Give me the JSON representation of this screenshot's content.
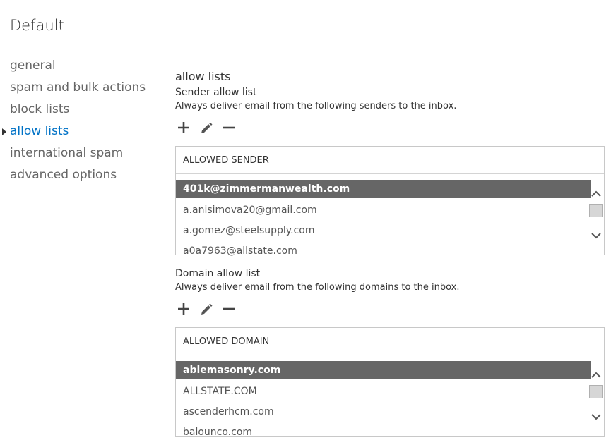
{
  "page": {
    "title": "Default"
  },
  "nav": {
    "items": [
      {
        "label": "general"
      },
      {
        "label": "spam and bulk actions"
      },
      {
        "label": "block lists"
      },
      {
        "label": "allow lists"
      },
      {
        "label": "international spam"
      },
      {
        "label": "advanced options"
      }
    ],
    "selected": "allow lists"
  },
  "content": {
    "section_title": "allow lists",
    "sender": {
      "label": "Sender allow list",
      "description": "Always deliver email from the following senders to the inbox.",
      "toolbar": {
        "add_icon": "plus-icon",
        "edit_icon": "pencil-icon",
        "remove_icon": "minus-icon"
      },
      "column_header": "ALLOWED SENDER",
      "rows": [
        "401k@zimmermanwealth.com",
        "a.anisimova20@gmail.com",
        "a.gomez@steelsupply.com",
        "a0a7963@allstate.com"
      ],
      "selected_row": "401k@zimmermanwealth.com"
    },
    "domain": {
      "label": "Domain allow list",
      "description": "Always deliver email from the following domains to the inbox.",
      "toolbar": {
        "add_icon": "plus-icon",
        "edit_icon": "pencil-icon",
        "remove_icon": "minus-icon"
      },
      "column_header": "ALLOWED DOMAIN",
      "rows": [
        "ablemasonry.com",
        "ALLSTATE.COM",
        "ascenderhcm.com",
        "balounco.com"
      ],
      "selected_row": "ablemasonry.com"
    }
  },
  "colors": {
    "accent": "#0072c6",
    "selected_row_bg": "#666666",
    "text": "#333333"
  }
}
